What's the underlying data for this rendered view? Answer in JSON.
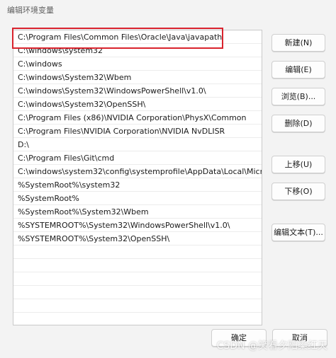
{
  "window": {
    "title": "编辑环境变量"
  },
  "paths": [
    "C:\\Program Files\\Common Files\\Oracle\\Java\\javapath",
    "C:\\windows\\system32",
    "C:\\windows",
    "C:\\windows\\System32\\Wbem",
    "C:\\windows\\System32\\WindowsPowerShell\\v1.0\\",
    "C:\\windows\\System32\\OpenSSH\\",
    "C:\\Program Files (x86)\\NVIDIA Corporation\\PhysX\\Common",
    "C:\\Program Files\\NVIDIA Corporation\\NVIDIA NvDLISR",
    "D:\\",
    "C:\\Program Files\\Git\\cmd",
    "C:\\windows\\system32\\config\\systemprofile\\AppData\\Local\\Micr...",
    "%SystemRoot%\\system32",
    "%SystemRoot%",
    "%SystemRoot%\\System32\\Wbem",
    "%SYSTEMROOT%\\System32\\WindowsPowerShell\\v1.0\\",
    "%SYSTEMROOT%\\System32\\OpenSSH\\"
  ],
  "buttons": {
    "new": "新建(N)",
    "edit": "编辑(E)",
    "browse": "浏览(B)...",
    "delete": "删除(D)",
    "move_up": "上移(U)",
    "move_down": "下移(O)",
    "edit_text": "编辑文本(T)...",
    "ok": "确定",
    "cancel": "取消"
  },
  "watermark": "CSDN @笑看夕阳染红天",
  "colors": {
    "highlight": "#d9232d",
    "background": "#f3f3f3"
  }
}
